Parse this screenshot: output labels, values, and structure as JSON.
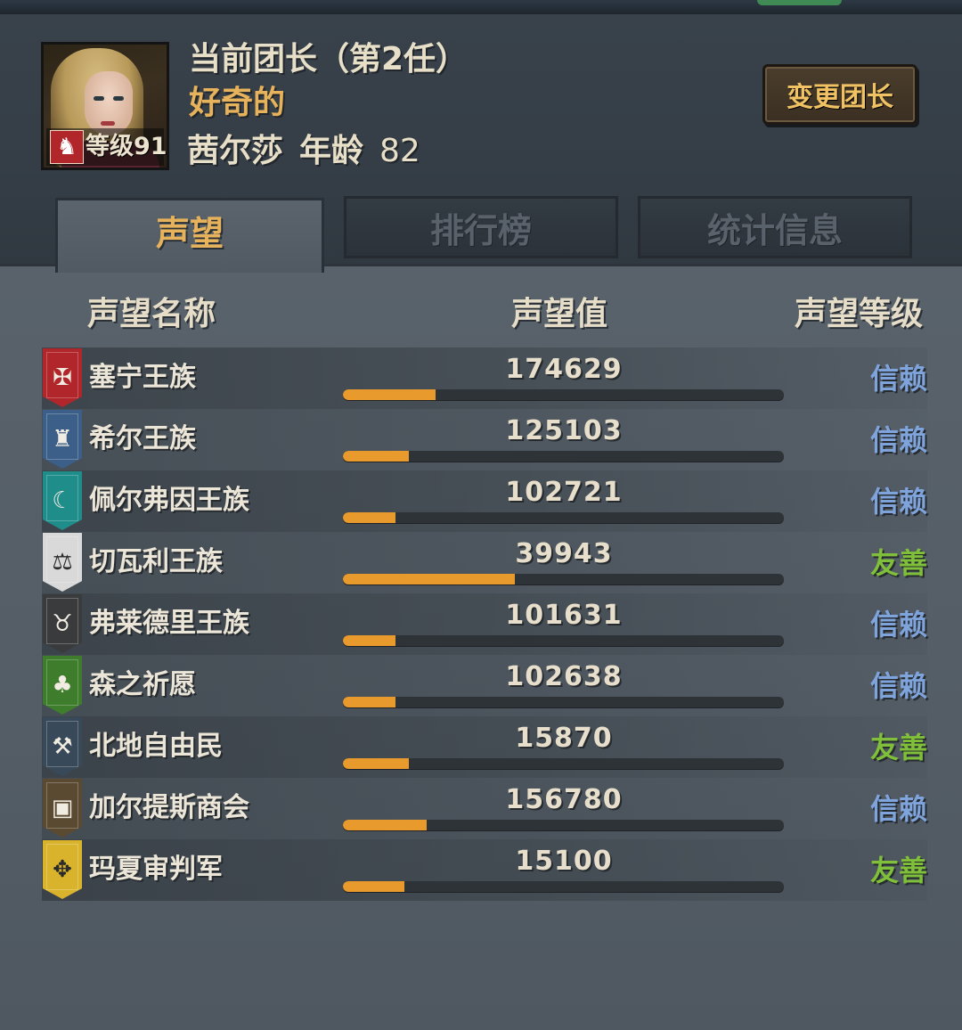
{
  "leader": {
    "title": "当前团长（第2任）",
    "trait": "好奇的",
    "name": "茜尔莎",
    "age_label": "年龄",
    "age": "82",
    "level_label": "等级91",
    "change_button": "变更团长"
  },
  "tabs": [
    {
      "label": "声望",
      "active": true
    },
    {
      "label": "排行榜",
      "active": false
    },
    {
      "label": "统计信息",
      "active": false
    }
  ],
  "columns": {
    "name": "声望名称",
    "value": "声望值",
    "level": "声望等级"
  },
  "colors": {
    "trust": "#7fa4dc",
    "friendly": "#7fbf3a",
    "bar_fill": "#e89a2c",
    "accent_gold": "#e6b25b"
  },
  "factions": [
    {
      "name": "塞宁王族",
      "value": "174629",
      "progress": 0.21,
      "level": "信赖",
      "level_type": "trust",
      "emblem_color": "#b1262b",
      "emblem_icon": "sword-crest-icon",
      "glyph": "✠"
    },
    {
      "name": "希尔王族",
      "value": "125103",
      "progress": 0.15,
      "level": "信赖",
      "level_type": "trust",
      "emblem_color": "#3b5f88",
      "emblem_icon": "castle-tower-icon",
      "glyph": "♜"
    },
    {
      "name": "佩尔弗因王族",
      "value": "102721",
      "progress": 0.12,
      "level": "信赖",
      "level_type": "trust",
      "emblem_color": "#1f8d8a",
      "emblem_icon": "crescent-flame-icon",
      "glyph": "☾"
    },
    {
      "name": "切瓦利王族",
      "value": "39943",
      "progress": 0.39,
      "level": "友善",
      "level_type": "friendly",
      "emblem_color": "#d9d9d9",
      "emblem_icon": "scales-icon",
      "glyph": "⚖"
    },
    {
      "name": "弗莱德里王族",
      "value": "101631",
      "progress": 0.12,
      "level": "信赖",
      "level_type": "trust",
      "emblem_color": "#3a3b3d",
      "emblem_icon": "bull-head-icon",
      "glyph": "♉"
    },
    {
      "name": "森之祈愿",
      "value": "102638",
      "progress": 0.12,
      "level": "信赖",
      "level_type": "trust",
      "emblem_color": "#3e7d2c",
      "emblem_icon": "tree-icon",
      "glyph": "♣"
    },
    {
      "name": "北地自由民",
      "value": "15870",
      "progress": 0.15,
      "level": "友善",
      "level_type": "friendly",
      "emblem_color": "#384a5a",
      "emblem_icon": "axe-icon",
      "glyph": "⚒"
    },
    {
      "name": "加尔提斯商会",
      "value": "156780",
      "progress": 0.19,
      "level": "信赖",
      "level_type": "trust",
      "emblem_color": "#5a4a32",
      "emblem_icon": "treasure-chest-icon",
      "glyph": "▣"
    },
    {
      "name": "玛夏审判军",
      "value": "15100",
      "progress": 0.14,
      "level": "友善",
      "level_type": "friendly",
      "emblem_color": "#d9b32c",
      "emblem_icon": "cross-shield-icon",
      "glyph": "✥"
    }
  ]
}
